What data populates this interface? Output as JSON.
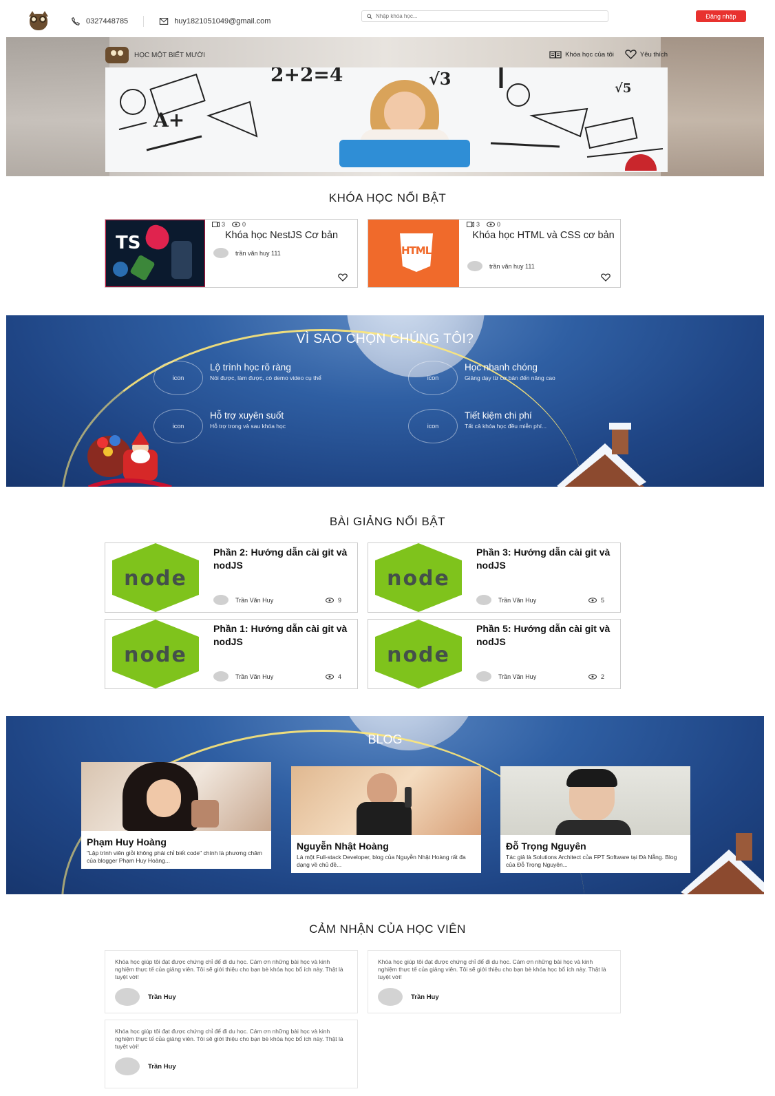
{
  "header": {
    "phone": "0327448785",
    "email": "huy1821051049@gmail.com",
    "search_placeholder": "Nhập khóa học...",
    "login_label": "Đăng nhập"
  },
  "hero": {
    "brand": "HỌC MỘT BIẾT MƯỜI",
    "nav": [
      {
        "label": "Khóa học của tôi",
        "icon": "book-open-icon"
      },
      {
        "label": "Yêu thích",
        "icon": "heart-icon"
      }
    ],
    "doodles": [
      "2+2=4",
      "√3",
      "A+",
      "√5"
    ]
  },
  "featured_courses": {
    "title": "KHÓA HỌC NỔI BẬT",
    "items": [
      {
        "videos": "3",
        "views": "0",
        "title": "Khóa học NestJS Cơ bản",
        "author": "trần văn huy 111",
        "thumb_text": "TS"
      },
      {
        "videos": "3",
        "views": "0",
        "title": "Khóa học HTML và CSS cơ bản",
        "author": "trần văn huy 111",
        "thumb_text": "HTML"
      }
    ]
  },
  "why": {
    "title": "VÌ SAO CHỌN CHÚNG TÔI?",
    "items": [
      {
        "icon": "icon",
        "head": "Lộ trình học rõ ràng",
        "sub": "Nói được, làm được, có demo video cụ thể"
      },
      {
        "icon": "icon",
        "head": "Học nhanh chóng",
        "sub": "Giảng dạy từ cơ bản đến nâng cao"
      },
      {
        "icon": "icon",
        "head": "Hỗ trợ xuyên suốt",
        "sub": "Hỗ trợ trong và sau khóa học"
      },
      {
        "icon": "icon",
        "head": "Tiết kiệm chi phí",
        "sub": "Tất cả khóa học đều miễn phí..."
      }
    ]
  },
  "lessons": {
    "title": "BÀI GIẢNG NỔI BẬT",
    "thumb_text": "node",
    "items": [
      {
        "title": "Phần 2: Hướng dẫn cài git và nodJS",
        "author": "Trần Văn Huy",
        "views": "9"
      },
      {
        "title": "Phần 3: Hướng dẫn cài git và nodJS",
        "author": "Trần Văn Huy",
        "views": "5"
      },
      {
        "title": "Phần 1: Hướng dẫn cài git và nodJS",
        "author": "Trần Văn Huy",
        "views": "4"
      },
      {
        "title": "Phần 5: Hướng dẫn cài git và nodJS",
        "author": "Trần Văn Huy",
        "views": "2"
      }
    ]
  },
  "blog": {
    "title": "BLOG",
    "items": [
      {
        "name": "Phạm Huy Hoàng",
        "desc": "\"Lập trình viên giỏi không phải chỉ biết code\" chính là phương châm của blogger Phạm Huy Hoàng..."
      },
      {
        "name": "Nguyễn Nhật Hoàng",
        "desc": "Là một Full-stack Developer, blog của Nguyễn Nhật Hoàng rất đa dạng về chủ đề..."
      },
      {
        "name": "Đỗ Trọng Nguyên",
        "desc": "Tác giả là Solutions Architect của FPT Software tại Đà Nẵng. Blog của Đỗ Trọng Nguyên..."
      }
    ]
  },
  "testimonials": {
    "title": "CẢM NHẬN CỦA HỌC VIÊN",
    "items": [
      {
        "text": "Khóa học giúp tôi đạt được chứng chỉ để đi du học. Cám ơn những bài học và kinh nghiệm thực tế của giảng viên. Tôi sẽ giới thiệu cho bạn bè khóa học bổ ích này. Thật là tuyệt vời!",
        "author": "Trần Huy"
      },
      {
        "text": "Khóa học giúp tôi đạt được chứng chỉ để đi du học. Cám ơn những bài học và kinh nghiệm thực tế của giảng viên. Tôi sẽ giới thiệu cho bạn bè khóa học bổ ích này. Thật là tuyệt vời!",
        "author": "Trần Huy"
      },
      {
        "text": "Khóa học giúp tôi đạt được chứng chỉ để đi du học. Cám ơn những bài học và kinh nghiệm thực tế của giảng viên. Tôi sẽ giới thiệu cho bạn bè khóa học bổ ích này. Thật là tuyệt vời!",
        "author": "Trần Huy"
      }
    ]
  },
  "colors": {
    "accent_red": "#e8322f",
    "node_green": "#7fc31c",
    "html_orange": "#f06a2b",
    "night_blue": "#2f5fa3"
  }
}
